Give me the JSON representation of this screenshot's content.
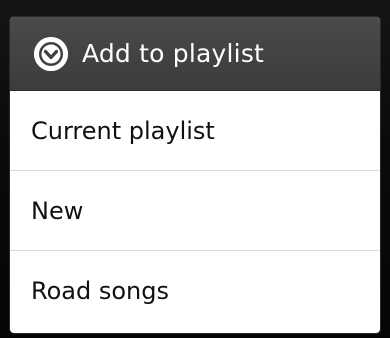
{
  "dialog": {
    "title": "Add to playlist",
    "icon": "chevron-down-circle-icon",
    "colors": {
      "header_bg": "#424242",
      "header_text": "#ffffff",
      "body_bg": "#ffffff",
      "divider": "#d9d9d9"
    },
    "options": [
      {
        "label": "Current playlist"
      },
      {
        "label": "New"
      },
      {
        "label": "Road songs"
      }
    ]
  }
}
